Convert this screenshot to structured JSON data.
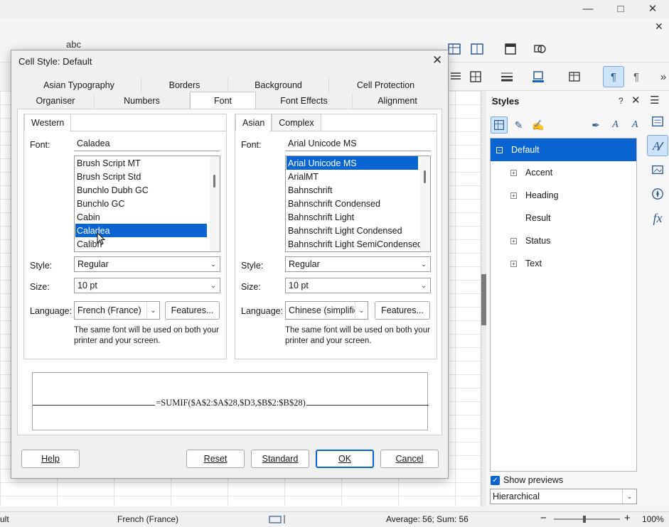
{
  "dialog": {
    "title": "Cell Style: Default",
    "tabs_row1": [
      "Asian Typography",
      "Borders",
      "Background",
      "Cell Protection"
    ],
    "tabs_row2": [
      "Organiser",
      "Numbers",
      "Font",
      "Font Effects",
      "Alignment"
    ],
    "active_tab": "Font",
    "western": {
      "tab_label": "Western",
      "font_label": "Font:",
      "font_value": "Caladea",
      "font_list": [
        "Brush Script MT",
        "Brush Script Std",
        "Bunchlo Dubh GC",
        "Bunchlo GC",
        "Cabin",
        "Caladea",
        "Calibri"
      ],
      "selected_font": "Caladea",
      "style_label": "Style:",
      "style_value": "Regular",
      "size_label": "Size:",
      "size_value": "10 pt",
      "language_label": "Language:",
      "language_value": "French (France)",
      "features_button": "Features...",
      "note": "The same font will be used on both your printer and your screen."
    },
    "asian": {
      "tab_label": "Asian",
      "complex_tab_label": "Complex",
      "font_label": "Font:",
      "font_value": "Arial Unicode MS",
      "font_list": [
        "Arial Unicode MS",
        "ArialMT",
        "Bahnschrift",
        "Bahnschrift Condensed",
        "Bahnschrift Light",
        "Bahnschrift Light Condensed",
        "Bahnschrift Light SemiCondensed"
      ],
      "selected_font": "Arial Unicode MS",
      "style_label": "Style:",
      "style_value": "Regular",
      "size_label": "Size:",
      "size_value": "10 pt",
      "language_label": "Language:",
      "language_value": "Chinese (simplified)",
      "features_button": "Features...",
      "note": "The same font will be used on both your printer and your screen."
    },
    "preview_text": "=SUMIF($A$2:$A$28,$D3,$B$2:$B$28)",
    "buttons": {
      "help": "Help",
      "reset": "Reset",
      "standard": "Standard",
      "ok": "OK",
      "cancel": "Cancel"
    }
  },
  "sidebar": {
    "title": "Styles",
    "help": "?",
    "styles": [
      {
        "label": "Default",
        "expandable": true,
        "selected": true,
        "level": 0
      },
      {
        "label": "Accent",
        "expandable": true,
        "selected": false,
        "level": 1
      },
      {
        "label": "Heading",
        "expandable": true,
        "selected": false,
        "level": 1
      },
      {
        "label": "Result",
        "expandable": false,
        "selected": false,
        "level": 1
      },
      {
        "label": "Status",
        "expandable": true,
        "selected": false,
        "level": 1
      },
      {
        "label": "Text",
        "expandable": true,
        "selected": false,
        "level": 1
      }
    ],
    "show_previews_label": "Show previews",
    "show_previews_checked": true,
    "filter_value": "Hierarchical"
  },
  "statusbar": {
    "left_fragment": "ult",
    "language": "French (France)",
    "summary": "Average: 56; Sum: 56",
    "zoom": "100%"
  },
  "colors": {
    "accent": "#0a64d2",
    "icon": "#2d5b8e"
  },
  "toolbar_partial_text": "abc"
}
